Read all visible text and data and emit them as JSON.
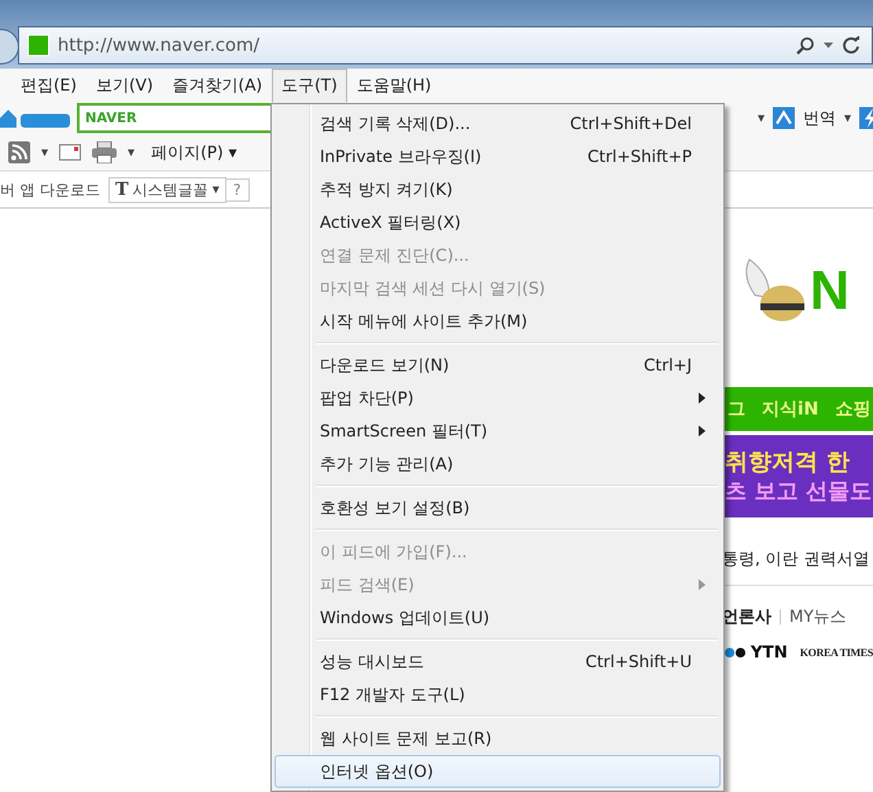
{
  "address_bar": {
    "url": "http://www.naver.com/"
  },
  "menu_bar": [
    {
      "label": "편집(E)",
      "selected": false
    },
    {
      "label": "보기(V)",
      "selected": false
    },
    {
      "label": "즐겨찾기(A)",
      "selected": false
    },
    {
      "label": "도구(T)",
      "selected": true
    },
    {
      "label": "도움말(H)",
      "selected": false
    }
  ],
  "toolbar": {
    "search_provider": "NAVER",
    "caret": "▾",
    "translate": "번역"
  },
  "command_bar": {
    "page_menu": "페이지(P)",
    "caret": "▾"
  },
  "font_bar": {
    "font_icon": "T",
    "label": "버 앱 다운로드",
    "font_button": "시스템글꼴",
    "font_caret": "▾",
    "help": "?"
  },
  "tools_menu": [
    {
      "kind": "item",
      "label": "검색 기록 삭제(D)...",
      "shortcut": "Ctrl+Shift+Del",
      "disabled": false,
      "submenu": false,
      "selected": false
    },
    {
      "kind": "item",
      "label": "InPrivate 브라우징(I)",
      "shortcut": "Ctrl+Shift+P",
      "disabled": false,
      "submenu": false,
      "selected": false
    },
    {
      "kind": "item",
      "label": "추적 방지 켜기(K)",
      "disabled": false,
      "submenu": false,
      "selected": false
    },
    {
      "kind": "item",
      "label": "ActiveX 필터링(X)",
      "disabled": false,
      "submenu": false,
      "selected": false
    },
    {
      "kind": "item",
      "label": "연결 문제 진단(C)...",
      "disabled": true,
      "submenu": false,
      "selected": false
    },
    {
      "kind": "item",
      "label": "마지막 검색 세션 다시 열기(S)",
      "disabled": true,
      "submenu": false,
      "selected": false
    },
    {
      "kind": "item",
      "label": "시작 메뉴에 사이트 추가(M)",
      "disabled": false,
      "submenu": false,
      "selected": false
    },
    {
      "kind": "separator"
    },
    {
      "kind": "item",
      "label": "다운로드 보기(N)",
      "shortcut": "Ctrl+J",
      "disabled": false,
      "submenu": false,
      "selected": false
    },
    {
      "kind": "item",
      "label": "팝업 차단(P)",
      "disabled": false,
      "submenu": true,
      "selected": false
    },
    {
      "kind": "item",
      "label": "SmartScreen 필터(T)",
      "disabled": false,
      "submenu": true,
      "selected": false
    },
    {
      "kind": "item",
      "label": "추가 기능 관리(A)",
      "disabled": false,
      "submenu": false,
      "selected": false
    },
    {
      "kind": "separator"
    },
    {
      "kind": "item",
      "label": "호환성 보기 설정(B)",
      "disabled": false,
      "submenu": false,
      "selected": false
    },
    {
      "kind": "separator"
    },
    {
      "kind": "item",
      "label": "이 피드에 가입(F)...",
      "disabled": true,
      "submenu": false,
      "selected": false
    },
    {
      "kind": "item",
      "label": "피드 검색(E)",
      "disabled": true,
      "submenu": true,
      "selected": false
    },
    {
      "kind": "item",
      "label": "Windows 업데이트(U)",
      "disabled": false,
      "submenu": false,
      "selected": false
    },
    {
      "kind": "separator"
    },
    {
      "kind": "item",
      "label": "성능 대시보드",
      "shortcut": "Ctrl+Shift+U",
      "disabled": false,
      "submenu": false,
      "selected": false
    },
    {
      "kind": "item",
      "label": "F12 개발자 도구(L)",
      "disabled": false,
      "submenu": false,
      "selected": false
    },
    {
      "kind": "separator"
    },
    {
      "kind": "item",
      "label": "웹 사이트 문제 보고(R)",
      "disabled": false,
      "submenu": false,
      "selected": false
    },
    {
      "kind": "item",
      "label": "인터넷 옵션(O)",
      "disabled": false,
      "submenu": false,
      "selected": true
    }
  ],
  "page": {
    "logo_text": "N",
    "nav_links": [
      "그",
      "지식iN",
      "쇼핑"
    ],
    "banner_lines": [
      "취향저격 한",
      "츠 보고 선물도"
    ],
    "headline": "통령, 이란 권력서열",
    "news_tabs": [
      {
        "label": "언론사",
        "selected": true
      },
      {
        "label": "MY뉴스",
        "selected": false
      }
    ],
    "press_logos": [
      "YTN",
      "KOREA TIMES"
    ]
  }
}
